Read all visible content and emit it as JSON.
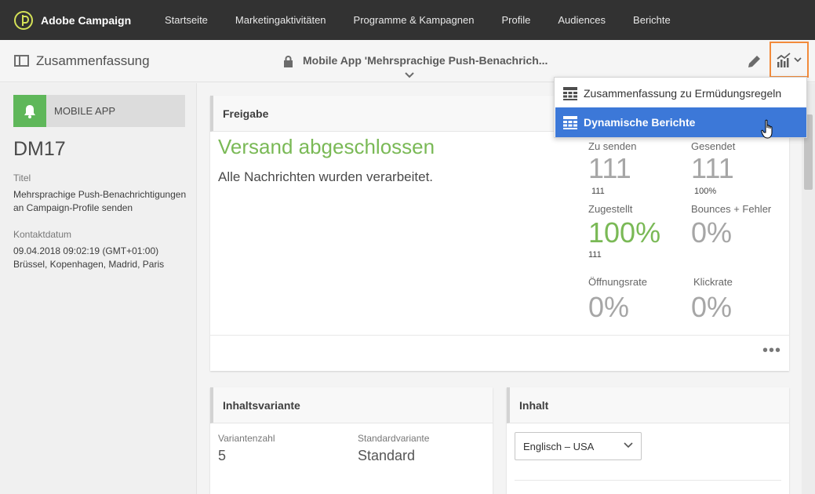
{
  "app": {
    "name": "Adobe Campaign"
  },
  "nav": {
    "items": [
      "Startseite",
      "Marketingaktivitäten",
      "Programme & Kampagnen",
      "Profile",
      "Audiences",
      "Berichte"
    ]
  },
  "header": {
    "section_title": "Zusammenfassung",
    "delivery_title": "Mobile App 'Mehrsprachige Push-Benachrich..."
  },
  "report_menu": {
    "items": [
      {
        "label": "Zusammenfassung zu Ermüdungsregeln",
        "active": false
      },
      {
        "label": "Dynamische Berichte",
        "active": true
      }
    ]
  },
  "sidebar": {
    "channel": "MOBILE APP",
    "code": "DM17",
    "title_label": "Titel",
    "title_value": "Mehrsprachige Push-Benachrichtigungen an Campaign-Profile senden",
    "contact_label": "Kontaktdatum",
    "contact_value": "09.04.2018 09:02:19 (GMT+01:00) Brüssel, Kopenhagen, Madrid, Paris"
  },
  "release": {
    "header": "Freigabe",
    "status": "Versand abgeschlossen",
    "message": "Alle Nachrichten wurden verarbeitet.",
    "kpis": {
      "to_send": {
        "label": "Zu senden",
        "value": "111",
        "sub": "111"
      },
      "sent": {
        "label": "Gesendet",
        "value": "111",
        "sub": "100%"
      },
      "delivered": {
        "label": "Zugestellt",
        "value": "100%",
        "sub": "111"
      },
      "bounces": {
        "label": "Bounces + Fehler",
        "value": "0%"
      },
      "open_rate": {
        "label": "Öffnungsrate",
        "value": "0%"
      },
      "click_rate": {
        "label": "Klickrate",
        "value": "0%"
      }
    },
    "more": "•••"
  },
  "variants": {
    "header": "Inhaltsvariante",
    "count_label": "Variantenzahl",
    "count_value": "5",
    "default_label": "Standardvariante",
    "default_value": "Standard"
  },
  "content": {
    "header": "Inhalt",
    "language": "Englisch – USA"
  },
  "colors": {
    "accent_green": "#7ab956",
    "highlight_orange": "#f28a3a",
    "menu_active": "#3c78d8",
    "topbar": "#323232"
  }
}
